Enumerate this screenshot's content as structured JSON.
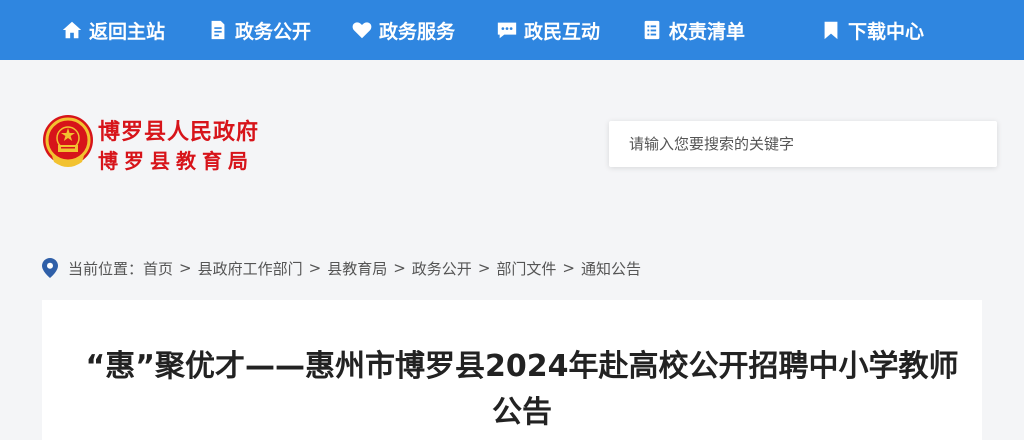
{
  "nav": {
    "items": [
      {
        "label": "返回主站",
        "icon": "home-icon"
      },
      {
        "label": "政务公开",
        "icon": "document-icon"
      },
      {
        "label": "政务服务",
        "icon": "heart-icon"
      },
      {
        "label": "政民互动",
        "icon": "chat-icon"
      },
      {
        "label": "权责清单",
        "icon": "list-icon"
      },
      {
        "label": "下载中心",
        "icon": "bookmark-icon"
      }
    ],
    "bg_color": "#2f86e0"
  },
  "logo": {
    "line1": "博罗县人民政府",
    "line2": "博罗县教育局",
    "color": "#d7141a"
  },
  "search": {
    "placeholder": "请输入您要搜索的关键字"
  },
  "breadcrumb": {
    "prefix": "当前位置：",
    "items": [
      "首页",
      "县政府工作部门",
      "县教育局",
      "政务公开",
      "部门文件",
      "通知公告"
    ],
    "separator": ">"
  },
  "article": {
    "title": "“惠”聚优才——惠州市博罗县2024年赴高校公开招聘中小学教师公告"
  }
}
